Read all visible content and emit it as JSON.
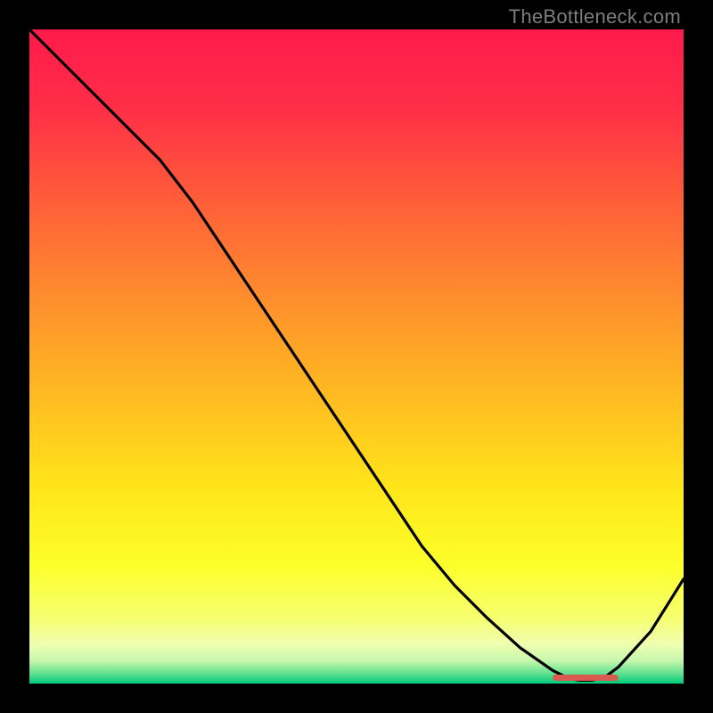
{
  "watermark": "TheBottleneck.com",
  "chart_data": {
    "type": "line",
    "title": "",
    "xlabel": "",
    "ylabel": "",
    "xlim": [
      0,
      100
    ],
    "ylim": [
      0,
      100
    ],
    "x": [
      0,
      5,
      10,
      15,
      20,
      25,
      30,
      35,
      40,
      45,
      50,
      55,
      60,
      65,
      70,
      75,
      80,
      82,
      84,
      86,
      88,
      90,
      95,
      100
    ],
    "values": [
      100,
      95.0,
      90.0,
      85.0,
      80.0,
      73.5,
      66.0,
      58.5,
      51.0,
      43.5,
      36.0,
      28.5,
      21.0,
      15.0,
      10.0,
      5.5,
      2.0,
      1.0,
      0.5,
      0.5,
      1.0,
      2.5,
      8.0,
      16.0
    ],
    "flat_marker": {
      "x_start": 80,
      "x_end": 90,
      "y": 0.9,
      "color": "#d85a50"
    },
    "background_gradient": {
      "stops": [
        {
          "pos": 0.0,
          "color": "#ff1a4b"
        },
        {
          "pos": 0.12,
          "color": "#ff2e47"
        },
        {
          "pos": 0.25,
          "color": "#ff5a3a"
        },
        {
          "pos": 0.4,
          "color": "#ff8a2e"
        },
        {
          "pos": 0.55,
          "color": "#ffb822"
        },
        {
          "pos": 0.7,
          "color": "#ffe51a"
        },
        {
          "pos": 0.82,
          "color": "#fcff2a"
        },
        {
          "pos": 0.9,
          "color": "#f6ff70"
        },
        {
          "pos": 0.94,
          "color": "#efffb0"
        },
        {
          "pos": 0.965,
          "color": "#c7f7ad"
        },
        {
          "pos": 0.985,
          "color": "#5ee08f"
        },
        {
          "pos": 1.0,
          "color": "#00c97b"
        }
      ]
    }
  }
}
